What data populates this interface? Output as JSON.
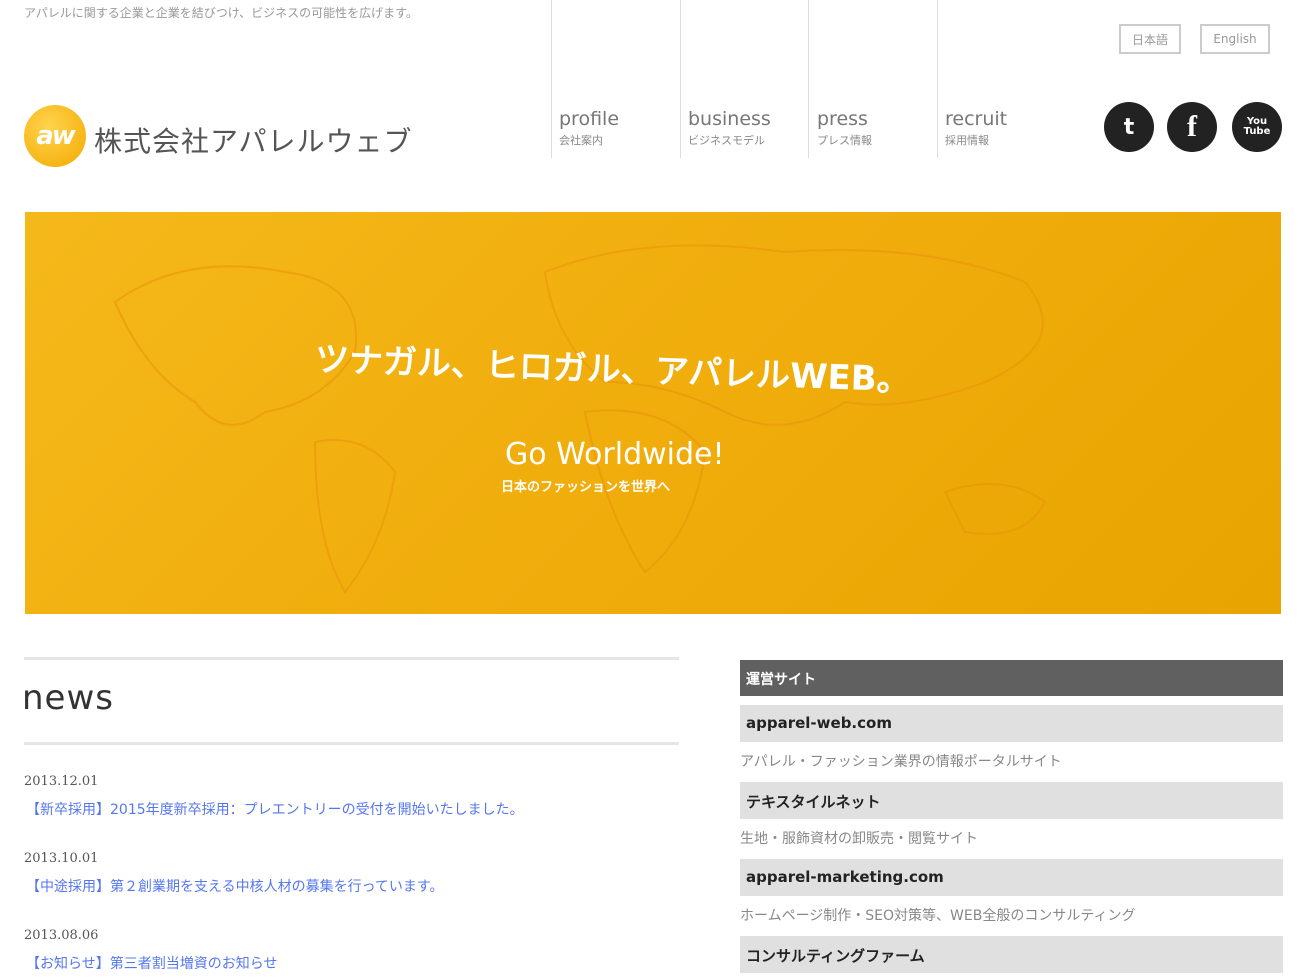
{
  "header": {
    "tagline": "アパレルに関する企業と企業を結びつけ、ビジネスの可能性を広げます。",
    "logo_mark": "aw",
    "company": "株式会社アパレルウェブ"
  },
  "nav": [
    {
      "en": "profile",
      "ja": "会社案内"
    },
    {
      "en": "business",
      "ja": "ビジネスモデル"
    },
    {
      "en": "press",
      "ja": "プレス情報"
    },
    {
      "en": "recruit",
      "ja": "採用情報"
    }
  ],
  "lang": {
    "ja": "日本語",
    "en": "English"
  },
  "social": {
    "twitter": "t",
    "facebook": "f",
    "youtube": "You Tube"
  },
  "banner": {
    "headline": "ツナガル、ヒロガル、アパレルWEB。",
    "sub": "Go Worldwide!",
    "sub_ja": "日本のファッションを世界へ"
  },
  "news": {
    "title": "news",
    "items": [
      {
        "date": "2013.12.01",
        "text": "【新卒採用】2015年度新卒採用：プレエントリーの受付を開始いたしました。"
      },
      {
        "date": "2013.10.01",
        "text": "【中途採用】第２創業期を支える中核人材の募集を行っています。"
      },
      {
        "date": "2013.08.06",
        "text": "【お知らせ】第三者割当増資のお知らせ"
      }
    ]
  },
  "sidebar": {
    "title": "運営サイト",
    "items": [
      {
        "name": "apparel-web.com",
        "desc": "アパレル・ファッション業界の情報ポータルサイト"
      },
      {
        "name": "テキスタイルネット",
        "desc": "生地・服飾資材の卸販売・閲覧サイト"
      },
      {
        "name": "apparel-marketing.com",
        "desc": "ホームページ制作・SEO対策等、WEB全般のコンサルティング"
      },
      {
        "name": "コンサルティングファーム",
        "desc": ""
      }
    ]
  },
  "colors": {
    "accent": "#f2b10f",
    "link": "#5577ee",
    "side_head": "#606060"
  }
}
